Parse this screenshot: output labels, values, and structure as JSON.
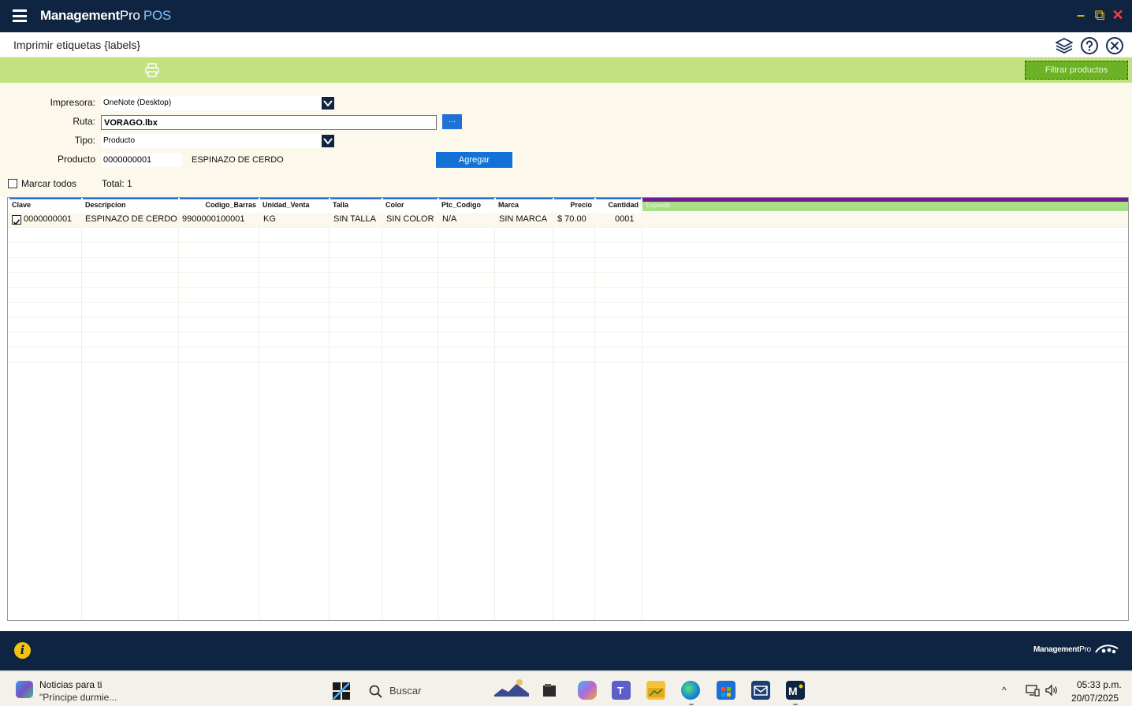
{
  "app": {
    "brand_bold": "Management",
    "brand_pro": "Pro",
    "brand_pos": " POS",
    "window_controls": {
      "minimize": "–",
      "restore": "⧉",
      "close": "✕"
    }
  },
  "subheader": {
    "title": "Imprimir etiquetas {labels}",
    "icons": [
      "layers-icon",
      "help-icon",
      "close-circle-icon"
    ]
  },
  "toolbar": {
    "print_icon": "printer-icon",
    "filter_button": "Filtrar productos"
  },
  "form": {
    "impresora_label": "Impresora:",
    "impresora_value": "OneNote (Desktop)",
    "ruta_label": "Ruta:",
    "ruta_value": "VORAGO.lbx",
    "browse_button": "...",
    "tipo_label": "Tipo:",
    "tipo_value": "Producto",
    "producto_label": "Producto",
    "producto_code": "0000000001",
    "producto_desc": "ESPINAZO DE CERDO",
    "agregar_button": "Agregar",
    "marcar_todos": "Marcar todos",
    "total": "Total: 1"
  },
  "grid": {
    "columns": [
      "Clave",
      "Descripcion",
      "Codigo_Barras",
      "Unidad_Venta",
      "Talla",
      "Color",
      "Ptc_Codigo",
      "Marca",
      "Precio",
      "Cantidad"
    ],
    "extra_column": "Expandir",
    "rows": [
      {
        "checked": true,
        "clave": "0000000001",
        "descripcion": "ESPINAZO DE CERDO",
        "codigo_barras": "9900000100001",
        "unidad_venta": "KG",
        "talla": "SIN TALLA",
        "color": "SIN COLOR",
        "ptc_codigo": "N/A",
        "marca": "SIN MARCA",
        "precio": "$ 70.00",
        "cantidad": "0001"
      }
    ]
  },
  "footer": {
    "info_icon": "i",
    "brand_bold": "Management",
    "brand_pro": "Pro"
  },
  "taskbar": {
    "news_title": "Noticias para ti",
    "news_subtitle": "\"Príncipe durmie...",
    "search_placeholder": "Buscar",
    "tray_chevron": "^",
    "clock_time": "05:33 p.m.",
    "clock_date": "20/07/2025"
  }
}
